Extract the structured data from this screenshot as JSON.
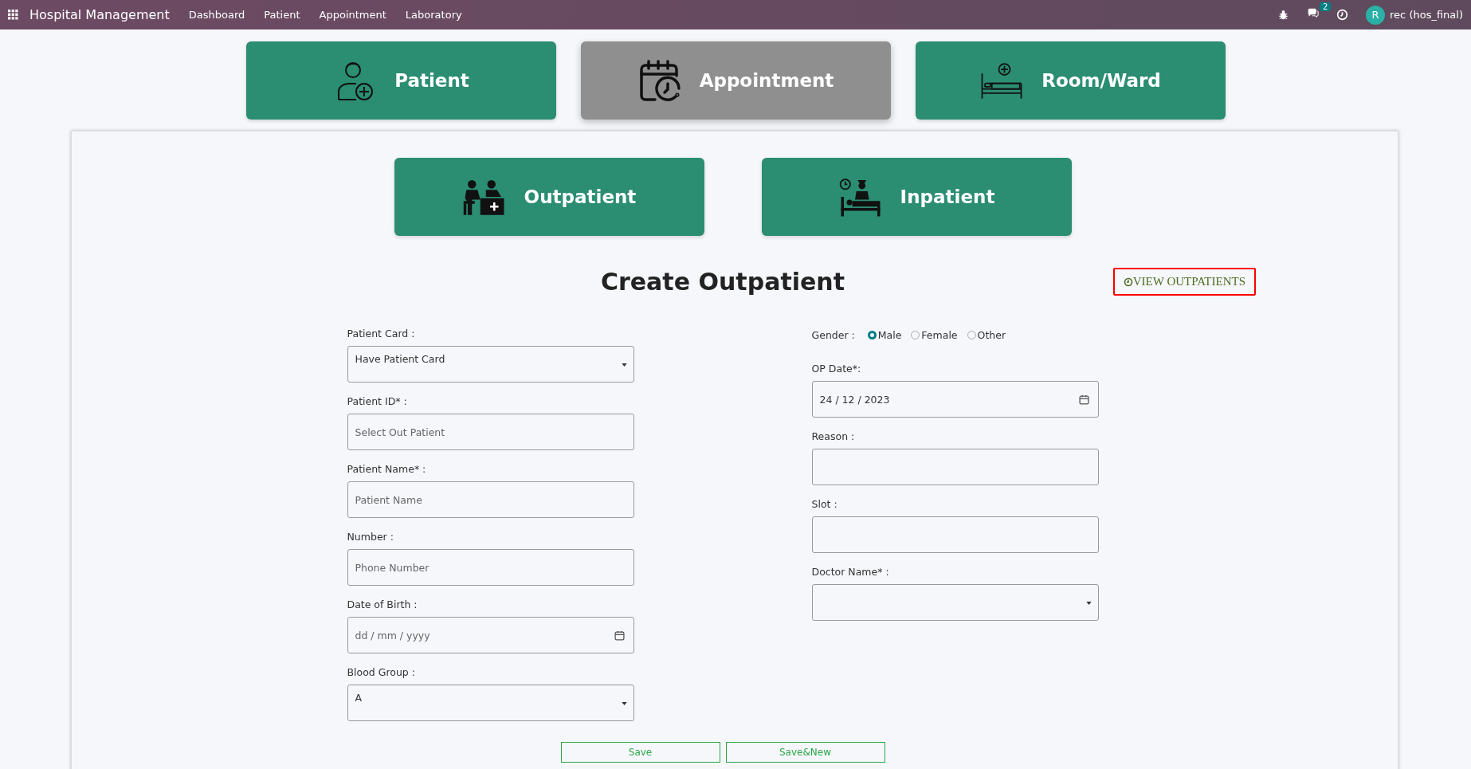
{
  "navbar": {
    "app_title": "Hospital Management",
    "menu": [
      "Dashboard",
      "Patient",
      "Appointment",
      "Laboratory"
    ],
    "message_count": "2",
    "user_initial": "R",
    "user_name": "rec (hos_final)"
  },
  "modules": [
    {
      "label": "Patient",
      "kind": "patient",
      "selected": false
    },
    {
      "label": "Appointment",
      "kind": "appointment",
      "selected": true
    },
    {
      "label": "Room/Ward",
      "kind": "room",
      "selected": false
    }
  ],
  "sub_modules": [
    {
      "label": "Outpatient",
      "kind": "outpatient",
      "selected": false
    },
    {
      "label": "Inpatient",
      "kind": "inpatient",
      "selected": false
    }
  ],
  "title": "Create Outpatient",
  "view_link": "VIEW OUTPATIENTS",
  "left_fields": [
    {
      "label": "Patient Card :",
      "kind": "select",
      "value": "Have Patient Card"
    },
    {
      "label": "Patient ID* :",
      "kind": "input",
      "placeholder": "Select Out Patient"
    },
    {
      "label": "Patient Name* :",
      "kind": "input",
      "placeholder": "Patient Name"
    },
    {
      "label": "Number :",
      "kind": "input",
      "placeholder": "Phone Number"
    },
    {
      "label": "Date of Birth :",
      "kind": "date",
      "placeholder": "dd / mm / yyyy"
    },
    {
      "label": "Blood Group :",
      "kind": "select",
      "value": "A"
    }
  ],
  "gender": {
    "label": "Gender :",
    "options": [
      {
        "label": "Male",
        "selected": true
      },
      {
        "label": "Female",
        "selected": false
      },
      {
        "label": "Other",
        "selected": false
      }
    ]
  },
  "right_fields": [
    {
      "label": "OP Date*:",
      "kind": "date",
      "value": "24 / 12 / 2023"
    },
    {
      "label": "Reason :",
      "kind": "input"
    },
    {
      "label": "Slot :",
      "kind": "input"
    },
    {
      "label": "Doctor Name* :",
      "kind": "select"
    }
  ],
  "buttons": [
    "Save",
    "Save&New"
  ]
}
